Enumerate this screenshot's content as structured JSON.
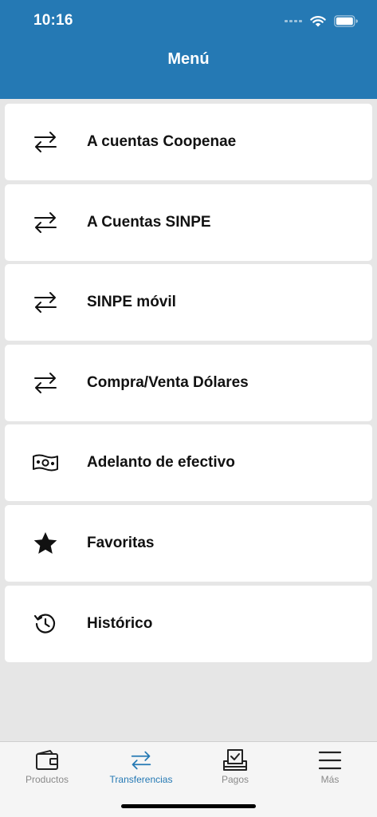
{
  "status_bar": {
    "time": "10:16"
  },
  "header": {
    "title": "Menú"
  },
  "menu": {
    "items": [
      {
        "label": "A cuentas Coopenae",
        "icon": "transfer-arrows-icon"
      },
      {
        "label": "A Cuentas SINPE",
        "icon": "transfer-arrows-icon"
      },
      {
        "label": "SINPE móvil",
        "icon": "transfer-arrows-icon"
      },
      {
        "label": "Compra/Venta Dólares",
        "icon": "transfer-arrows-icon"
      },
      {
        "label": "Adelanto de efectivo",
        "icon": "cash-bill-icon"
      },
      {
        "label": "Favoritas",
        "icon": "star-icon"
      },
      {
        "label": "Histórico",
        "icon": "history-clock-icon"
      }
    ]
  },
  "tabbar": {
    "tabs": [
      {
        "label": "Productos",
        "icon": "wallet-icon",
        "active": false
      },
      {
        "label": "Transferencias",
        "icon": "transfer-arrows-icon",
        "active": true
      },
      {
        "label": "Pagos",
        "icon": "ballot-box-icon",
        "active": false
      },
      {
        "label": "Más",
        "icon": "hamburger-menu-icon",
        "active": false
      }
    ]
  },
  "colors": {
    "header": "#2579b4",
    "accent": "#2579b4",
    "background": "#e6e6e6",
    "tab_inactive": "#8a8a8a"
  }
}
